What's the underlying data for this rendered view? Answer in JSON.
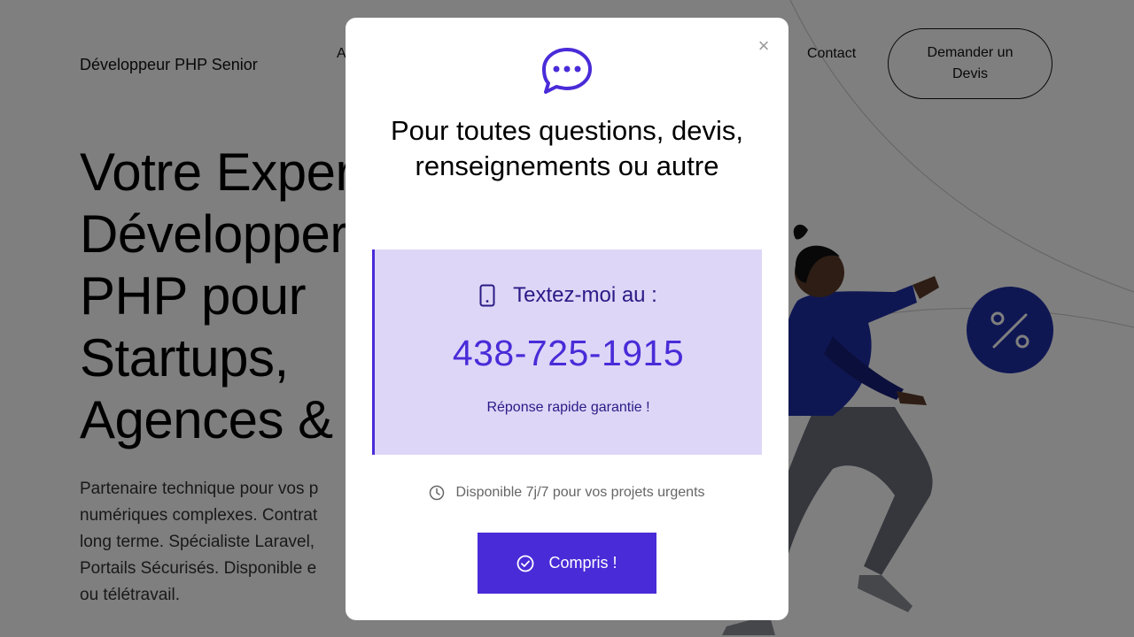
{
  "header": {
    "brand": "Développeur PHP Senior",
    "nav_partial": "A",
    "nav_contact": "Contact",
    "quote_button": "Demander un Devis"
  },
  "hero": {
    "title_lines": [
      "Votre Exper",
      "Développer",
      "PHP pour",
      "Startups,",
      "Agences & "
    ],
    "subtitle_lines": [
      "Partenaire technique pour vos p",
      "numériques complexes. Contrat",
      "long terme. Spécialiste Laravel,",
      "Portails Sécurisés. Disponible e",
      "ou télétravail."
    ]
  },
  "modal": {
    "title": "Pour toutes questions, devis, renseignements ou autre",
    "sms_label": "Textez-moi au :",
    "phone_number": "438-725-1915",
    "sms_note": "Réponse rapide garantie !",
    "availability": "Disponible 7j/7 pour vos projets urgents",
    "confirm_button": "Compris !",
    "close_symbol": "×"
  },
  "icons": {
    "chat": "chat-bubble-icon",
    "phone": "mobile-phone-icon",
    "clock": "clock-icon",
    "check": "check-circle-icon",
    "percent": "percent-icon"
  },
  "colors": {
    "accent": "#4a2bd8",
    "sms_box_bg": "#ddd6f7",
    "sms_text": "#2a1a86",
    "overlay": "rgba(0,0,0,0.5)",
    "illustration_blue": "#1f2ea6"
  }
}
